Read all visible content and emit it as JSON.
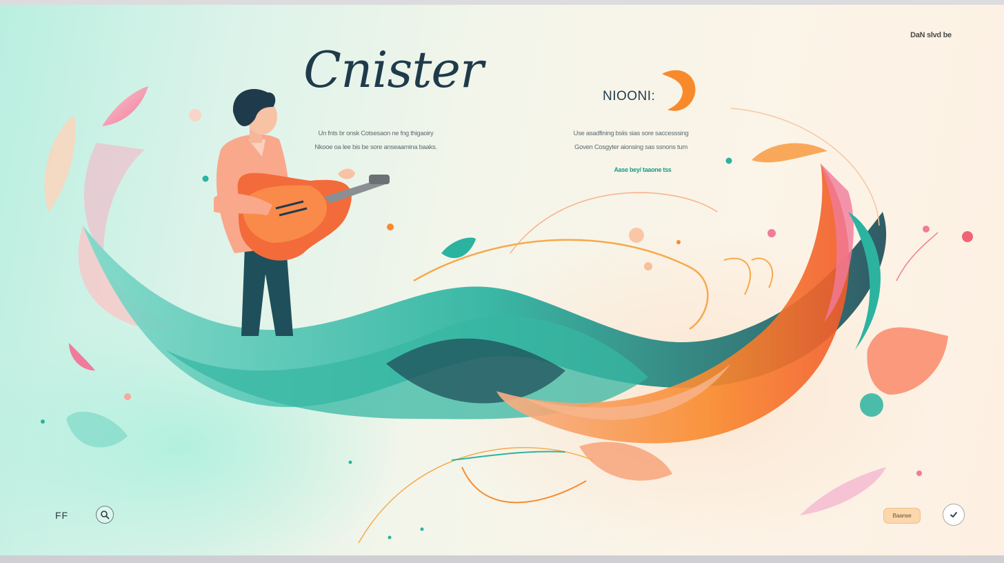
{
  "header": {
    "top_link": "DaN slvd be",
    "title": "Cnister",
    "tagline_lines": [
      "Un fnts br onsk Cotsesaon ne fng thigaoiry",
      "Nkooe oa lee bis be sore anseaamina baaks."
    ]
  },
  "brand": {
    "name": "NIOONI:",
    "description_lines": [
      "Use asadfining bsiis sias sore saccesssing",
      "Goven Cosgyter aionsing sas ssnons tum"
    ],
    "cta_link": "Aase bey/ taaone tss"
  },
  "footer": {
    "left_label": "FF",
    "search_icon": "search-icon",
    "pill_button": "Baanse",
    "confirm_icon": "checkmark-icon"
  },
  "colors": {
    "teal": "#2bb3a0",
    "deep_teal": "#1f4f5a",
    "orange": "#f98a2c",
    "pink": "#f07b9a",
    "navy_text": "#1f3b4b",
    "pill_bg": "#fbd7ac"
  }
}
